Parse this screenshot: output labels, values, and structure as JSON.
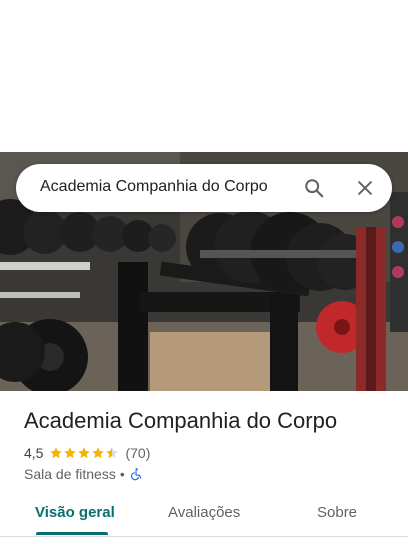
{
  "search": {
    "query": "Academia Companhia do Corpo"
  },
  "place": {
    "name": "Academia Companhia do Corpo",
    "rating": "4,5",
    "stars": 4.5,
    "review_count": "(70)",
    "category": "Sala de fitness",
    "separator": "•"
  },
  "tabs": [
    {
      "label": "Visão geral",
      "active": true
    },
    {
      "label": "Avaliações",
      "active": false
    },
    {
      "label": "Sobre",
      "active": false
    }
  ],
  "icons": {
    "search": "search-icon",
    "close": "close-icon",
    "accessibility": "wheelchair-icon",
    "star": "star-icon"
  },
  "colors": {
    "accent": "#0b6e6e",
    "star": "#f4b400",
    "accessibility": "#1a73e8"
  }
}
